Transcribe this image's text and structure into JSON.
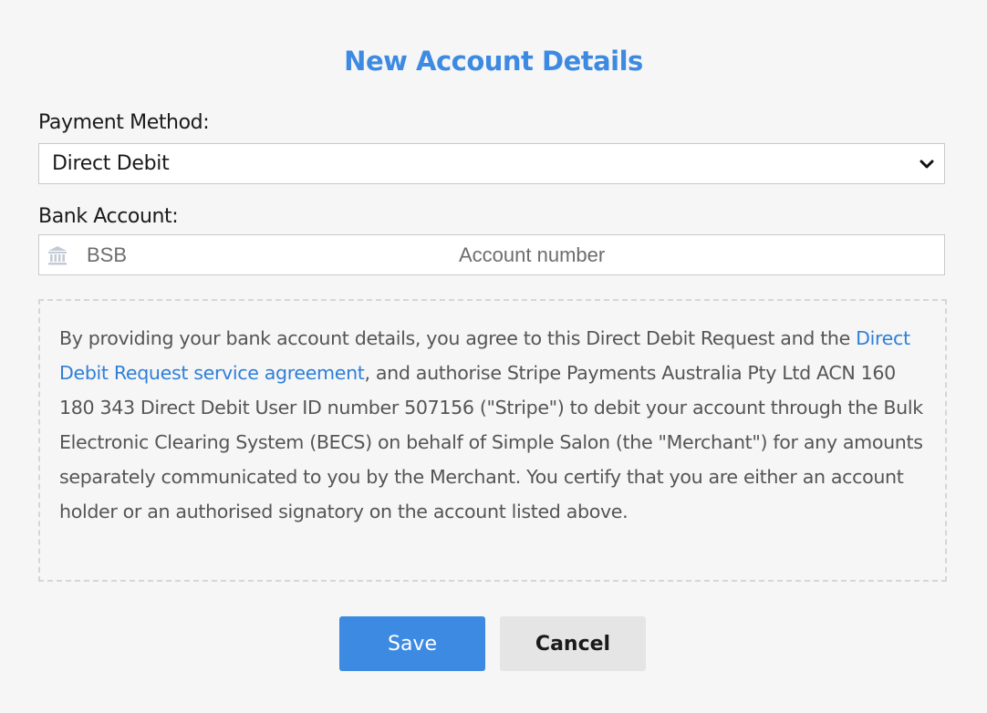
{
  "form": {
    "title": "New Account Details",
    "payment_method_label": "Payment Method:",
    "payment_method_value": "Direct Debit",
    "bank_account_label": "Bank Account:",
    "bsb_placeholder": "BSB",
    "account_number_placeholder": "Account number",
    "mandate": {
      "text_before_link": "By providing your bank account details, you agree to this Direct Debit Request and the ",
      "link_text": "Direct Debit Request service agreement",
      "text_after_link": ", and authorise Stripe Payments Australia Pty Ltd ACN 160 180 343 Direct Debit User ID number 507156 (\"Stripe\") to debit your account through the Bulk Electronic Clearing System (BECS) on behalf of Simple Salon (the \"Merchant\") for any amounts separately communicated to you by the Merchant. You certify that you are either an account holder or an authorised signatory on the account listed above."
    },
    "save_label": "Save",
    "cancel_label": "Cancel"
  },
  "icons": {
    "select_arrow": "chevron-down-icon",
    "bank": "bank-icon"
  },
  "colors": {
    "accent": "#3d8ae3",
    "title": "#3d8ae3",
    "link": "#2f7fd8",
    "background": "#f6f6f6"
  }
}
